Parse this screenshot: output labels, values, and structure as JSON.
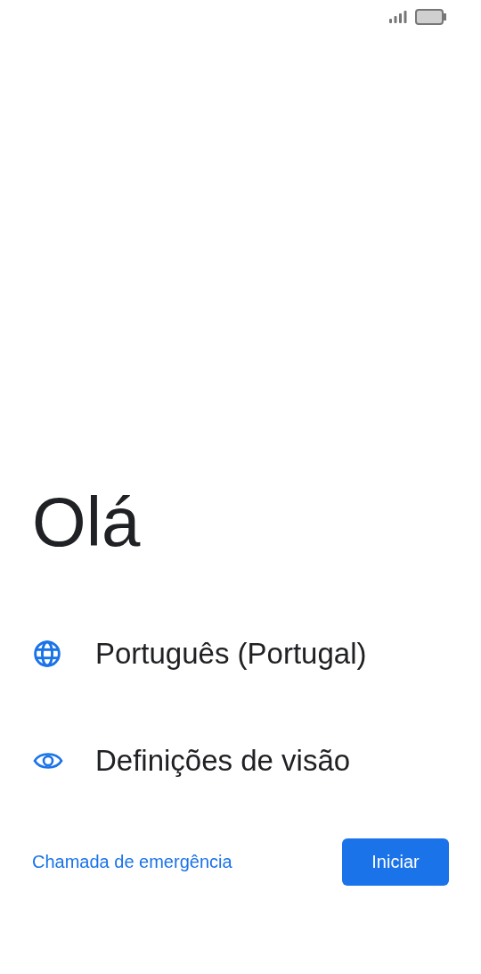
{
  "title": "Olá",
  "options": [
    {
      "kind": "language",
      "label": "Português (Portugal)"
    },
    {
      "kind": "vision",
      "label": "Definições de visão"
    }
  ],
  "emergency_link": "Chamada de emergência",
  "start_button": "Iniciar"
}
